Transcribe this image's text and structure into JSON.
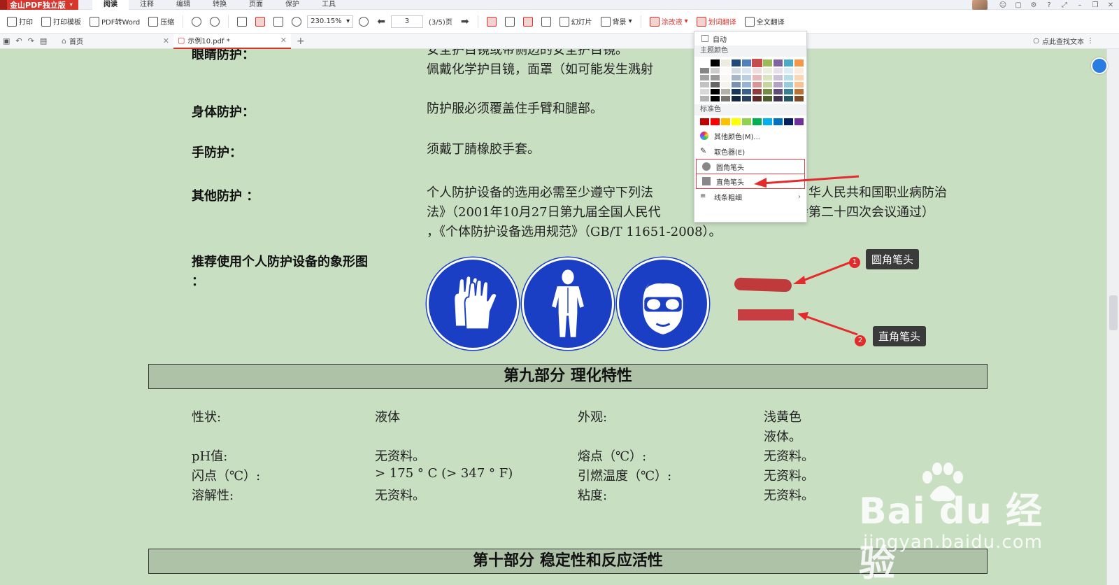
{
  "menubar": {
    "app_title": "金山PDF独立版",
    "tabs": [
      "阅读",
      "注释",
      "编辑",
      "转换",
      "页面",
      "保护",
      "工具"
    ],
    "active_tab": "阅读"
  },
  "toolbar": {
    "print": "打印",
    "print_template": "打印模板",
    "pdf_to_word": "PDF转Word",
    "compress": "压缩",
    "zoom": "230.15%",
    "page_current": "3",
    "page_total": "(3/5)页",
    "slideshow": "幻灯片",
    "background": "背景",
    "highlight": "涂改液",
    "word_translate": "划词翻译",
    "full_translate": "全文翻译"
  },
  "tabbar": {
    "home": "首页",
    "file": "示例10.pdf *",
    "search": "点此查找文本"
  },
  "dropdown": {
    "auto": "自动",
    "theme_colors": "主题颜色",
    "standard_colors": "标准色",
    "more_colors": "其他颜色(M)...",
    "eyedropper": "取色器(E)",
    "round_pen": "圆角笔头",
    "square_pen": "直角笔头",
    "line_weight": "线条粗细",
    "theme_top": [
      "#ffffff",
      "#000000",
      "#eeece1",
      "#1f497d",
      "#4f81bd",
      "#c0504d",
      "#9bbb59",
      "#8064a2",
      "#4bacc6",
      "#f79646"
    ],
    "standard": [
      "#c00000",
      "#ff0000",
      "#ffc000",
      "#ffff00",
      "#92d050",
      "#00b050",
      "#00b0f0",
      "#0070c0",
      "#002060",
      "#7030a0"
    ]
  },
  "doc": {
    "eye_text": "安全护目镜或带侧边的安全护目镜。",
    "eye_label": "眼睛防护：",
    "eye_text2": "佩戴化学护目镜，面罩（如可能发生溅射",
    "body_label": "身体防护：",
    "body_text": "防护服必须覆盖住手臂和腿部。",
    "hand_label": "手防护：",
    "hand_text": "须戴丁腈橡胶手套。",
    "other_label": "其他防护 ：",
    "other_line1": "个人防护设备的选用必需至少遵守下列法",
    "other_line1b": "华人民共和国职业病防治",
    "other_line2": "法》（2001年10月27日第九届全国人民代",
    "other_line2b": "会第二十四次会议通过）",
    "other_line3": "，《个体防护设备选用规范》（GB/T 11651-2008）。",
    "pictogram_label": "推荐使用个人防护设备的象形图",
    "pictogram_colon": "：",
    "section9": "第九部分  理化特性",
    "section10": "第十部分  稳定性和反应活性",
    "props": [
      {
        "k1": "性状:",
        "v1": "液体",
        "k2": "外观:",
        "v2": "浅黄色"
      },
      {
        "k1": "",
        "v1": "",
        "k2": "",
        "v2": "液体。"
      },
      {
        "k1": "pH值:",
        "v1": "无资料。",
        "k2": "熔点（℃）:",
        "v2": "无资料。"
      },
      {
        "k1": "闪点（℃）:",
        "v1": "> 175 ° C (> 347 ° F)",
        "k2": "引燃温度（℃）:",
        "v2": "无资料。"
      },
      {
        "k1": "溶解性:",
        "v1": "无资料。",
        "k2": "粘度:",
        "v2": "无资料。"
      }
    ]
  },
  "annotations": {
    "badge1": "1",
    "callout1": "圆角笔头",
    "badge2": "2",
    "callout2": "直角笔头"
  },
  "watermark": {
    "main": "Bai du 经验",
    "sub": "jingyan.baidu.com"
  },
  "colors": {
    "accent": "#d9352c",
    "doc_bg": "#c9dfc2",
    "sign_blue": "#1a3fc4",
    "stroke_red": "#c0393b"
  }
}
